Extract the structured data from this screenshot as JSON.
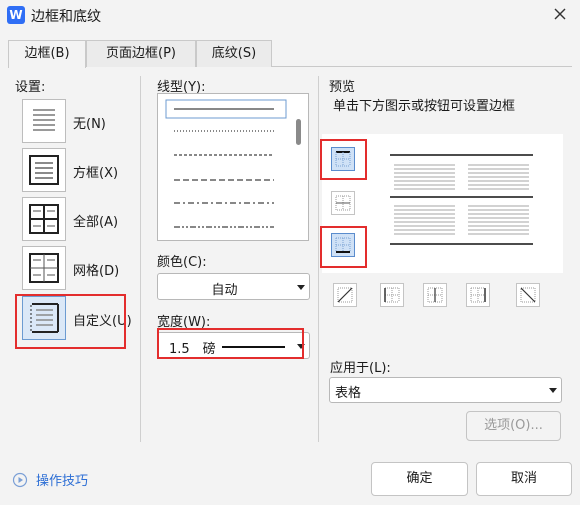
{
  "window": {
    "title": "边框和底纹",
    "app_icon": "W"
  },
  "tabs": [
    {
      "label": "边框(B)",
      "active": true
    },
    {
      "label": "页面边框(P)",
      "active": false
    },
    {
      "label": "底纹(S)",
      "active": false
    }
  ],
  "settings": {
    "heading": "设置:",
    "items": [
      {
        "label": "无(N)"
      },
      {
        "label": "方框(X)"
      },
      {
        "label": "全部(A)"
      },
      {
        "label": "网格(D)"
      },
      {
        "label": "自定义(U)"
      }
    ]
  },
  "line_style": {
    "heading": "线型(Y):"
  },
  "color": {
    "heading": "颜色(C):",
    "value": "自动"
  },
  "width": {
    "heading": "宽度(W):",
    "value": "1.5　磅"
  },
  "preview": {
    "heading": "预览",
    "hint": "单击下方图示或按钮可设置边框"
  },
  "apply_to": {
    "heading": "应用于(L):",
    "value": "表格"
  },
  "options_button": "选项(O)...",
  "tips_link": "操作技巧",
  "ok_button": "确定",
  "cancel_button": "取消",
  "colors": {
    "accent": "#2f6ef5",
    "highlight": "#e32d2d",
    "link": "#2c6ed5"
  }
}
